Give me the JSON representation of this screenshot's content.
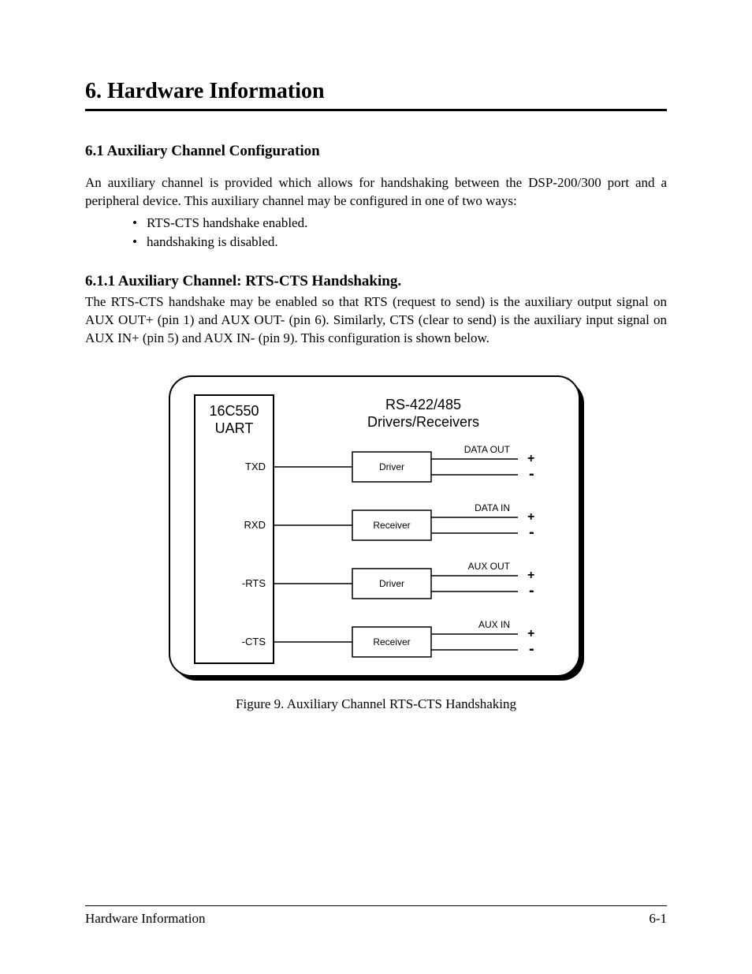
{
  "chapter_title": "6.  Hardware Information",
  "section_title": "6.1  Auxiliary Channel Configuration",
  "section_body": "An auxiliary channel is provided which allows for handshaking between the DSP-200/300 port and a peripheral device.  This auxiliary channel may be configured in one of two ways:",
  "bullets": [
    "RTS-CTS handshake enabled.",
    "handshaking is disabled."
  ],
  "subsection_title": "6.1.1  Auxiliary Channel:  RTS-CTS Handshaking.",
  "subsection_body": "The RTS-CTS handshake may be enabled so that RTS (request to send) is the auxiliary output signal on AUX OUT+ (pin 1) and AUX OUT- (pin 6).  Similarly, CTS (clear to send) is the auxiliary input signal on AUX IN+ (pin 5) and AUX IN- (pin 9).  This configuration is shown below.",
  "diagram": {
    "left_block": {
      "line1": "16C550",
      "line2": "UART"
    },
    "right_title": {
      "line1": "RS-422/485",
      "line2": "Drivers/Receivers"
    },
    "rows": [
      {
        "uart_label": "TXD",
        "box_label": "Driver",
        "out_label": "DATA OUT"
      },
      {
        "uart_label": "RXD",
        "box_label": "Receiver",
        "out_label": "DATA IN"
      },
      {
        "uart_label": "-RTS",
        "box_label": "Driver",
        "out_label": "AUX OUT"
      },
      {
        "uart_label": "-CTS",
        "box_label": "Receiver",
        "out_label": "AUX IN"
      }
    ],
    "plus": "+",
    "minus": "-"
  },
  "figure_caption": "Figure 9.  Auxiliary Channel RTS-CTS Handshaking",
  "footer": {
    "left": "Hardware Information",
    "right": "6-1"
  }
}
